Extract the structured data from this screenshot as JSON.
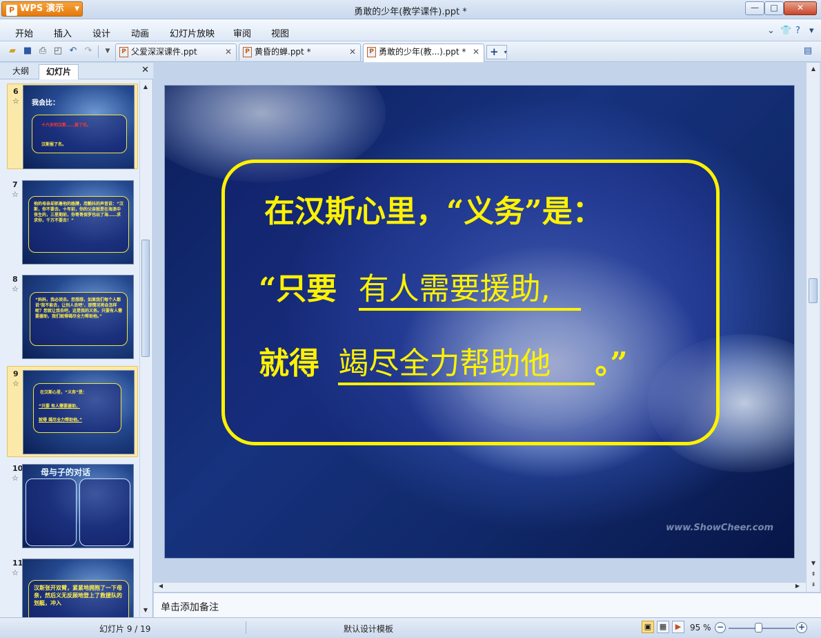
{
  "app": {
    "brand": "WPS 演示",
    "window_title": "勇敢的少年(教学课件).ppt *"
  },
  "menu": [
    "开始",
    "插入",
    "设计",
    "动画",
    "幻灯片放映",
    "审阅",
    "视图"
  ],
  "doc_tabs": [
    {
      "label": "父爱深深课件.ppt",
      "active": false
    },
    {
      "label": "黄昏的蝉.ppt *",
      "active": false
    },
    {
      "label": "勇敢的少年(教...).ppt *",
      "active": true
    }
  ],
  "left_pane": {
    "tabs": [
      "大纲",
      "幻灯片"
    ],
    "active_tab": "幻灯片",
    "thumbnails": [
      {
        "num": "6",
        "selected": false,
        "lines": [
          "我会比：",
          "十六岁的汉斯……报了名。",
          "汉斯报了名。"
        ]
      },
      {
        "num": "7",
        "selected": false,
        "lines": [
          "他的母亲却抓着他的胳膊，用颤抖的声音说：“汉斯，你不要去。十年前，你的父亲就是在海浪中丧生的，三星期前，你哥哥保罗也出了海……求求你，千万不要去！”"
        ]
      },
      {
        "num": "8",
        "selected": false,
        "lines": [
          "“妈妈，我必须去。您想想，如果我们每个人都说‘我不能去，让别人去吧’，那情况将会怎样呢？您就让我去吧，这是我的义务。只要有人需要援助，我们就得竭尽全力帮助他。”"
        ]
      },
      {
        "num": "9",
        "selected": true,
        "lines": [
          "在汉斯心里，“义务”是：",
          "“只要 有人需要援助，",
          "就得 竭尽全力帮助他。”"
        ]
      },
      {
        "num": "10",
        "selected": false,
        "lines": [
          "母与子的对话"
        ]
      },
      {
        "num": "11",
        "selected": false,
        "lines": [
          "汉斯张开双臂，紧紧地拥抱了一下母亲，然后义无反顾地登上了救援队的划艇，冲入"
        ]
      }
    ]
  },
  "slide": {
    "line1": "在汉斯心里，“义务”是：",
    "line2_prefix": "“只要",
    "line2_answer": "有人需要援助,",
    "line3_prefix": "就得",
    "line3_answer": "竭尽全力帮助他",
    "line3_suffix": "。”",
    "watermark": "www.ShowCheer.com"
  },
  "notes_placeholder": "单击添加备注",
  "status": {
    "slide_counter": "幻灯片 9 / 19",
    "template": "默认设计模板",
    "zoom": "95 %"
  }
}
